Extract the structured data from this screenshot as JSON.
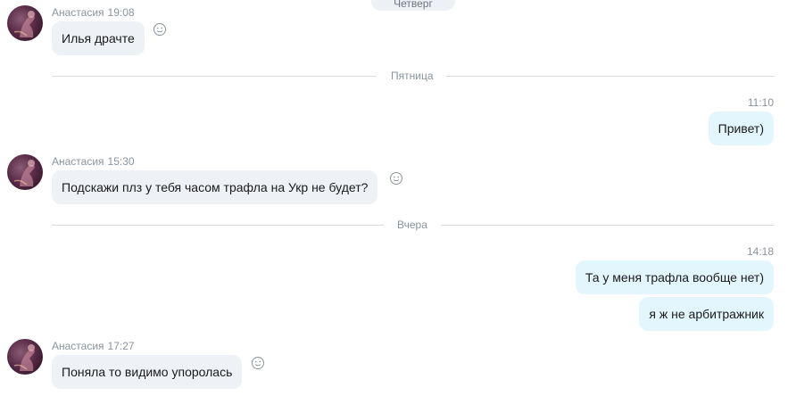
{
  "top_date_label": "Четверг",
  "messages": [
    {
      "sender": "Анастасия",
      "time": "19:08",
      "text": "Илья драчте"
    },
    {
      "divider": "Пятница"
    },
    {
      "out_time": "11:10",
      "text": "Привет)"
    },
    {
      "sender": "Анастасия",
      "time": "15:30",
      "text": "Подскажи плз у тебя часом трафла на Укр не будет?"
    },
    {
      "divider": "Вчера"
    },
    {
      "out_time": "14:18",
      "text": "Та у меня трафла вообще нет)",
      "text2": "я ж не арбитражник"
    },
    {
      "sender": "Анастасия",
      "time": "17:27",
      "text": "Поняла то видимо упоролась"
    }
  ]
}
